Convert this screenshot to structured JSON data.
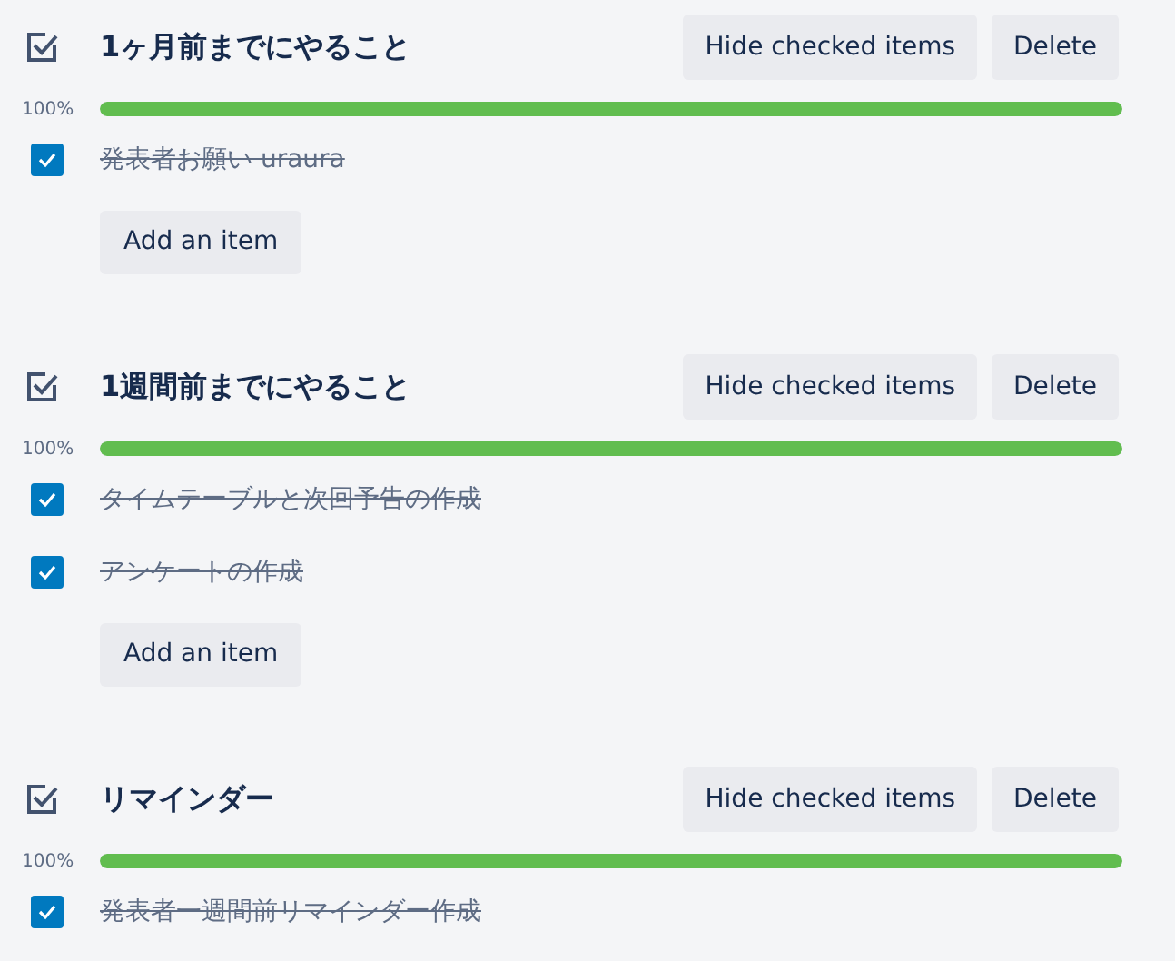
{
  "checklists": [
    {
      "title": "1ヶ月前までにやること",
      "hide_button": "Hide checked items",
      "delete_button": "Delete",
      "percent": "100%",
      "level": 1,
      "items": [
        {
          "text": "発表者お願い uraura",
          "checked": true
        }
      ],
      "add_button": "Add an item"
    },
    {
      "title": "1週間前までにやること",
      "hide_button": "Hide checked items",
      "delete_button": "Delete",
      "percent": "100%",
      "level": 1,
      "items": [
        {
          "text": "タイムテーブルと次回予告の作成",
          "checked": true
        },
        {
          "text": "アンケートの作成",
          "checked": true
        }
      ],
      "add_button": "Add an item"
    },
    {
      "title": "リマインダー",
      "hide_button": "Hide checked items",
      "delete_button": "Delete",
      "percent": "100%",
      "level": 1,
      "items": [
        {
          "text": "発表者一週間前リマインダー作成",
          "checked": true
        }
      ]
    }
  ]
}
